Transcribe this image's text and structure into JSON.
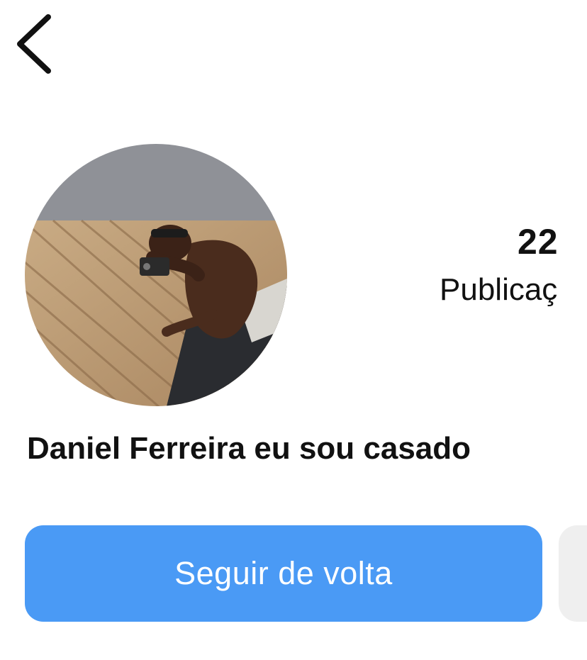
{
  "header": {
    "back_icon": "chevron-left-icon"
  },
  "profile": {
    "name": "Daniel Ferreira eu sou casado",
    "avatar_alt": "profile-photo"
  },
  "stats": {
    "posts_count": "22",
    "posts_label": "Publicaç"
  },
  "actions": {
    "follow_back_label": "Seguir de volta",
    "follow_back_color": "#4a9af5",
    "secondary_button_color": "#efefef"
  }
}
